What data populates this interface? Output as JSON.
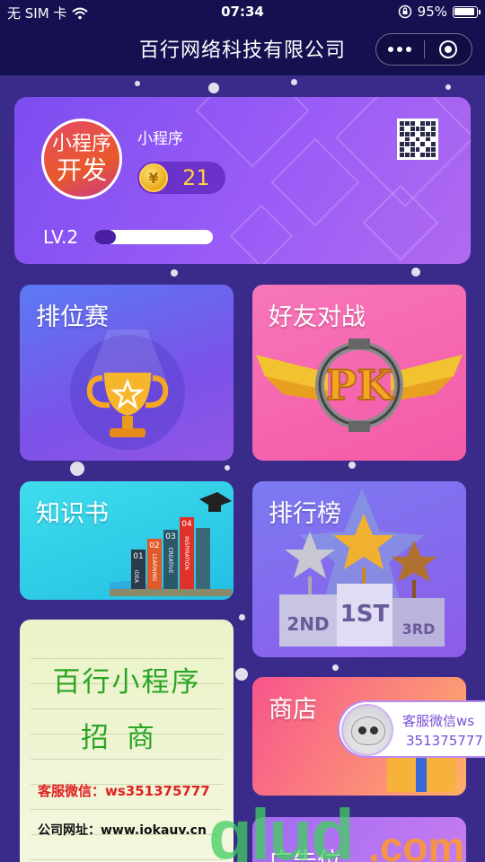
{
  "status_bar": {
    "carrier": "无 SIM 卡",
    "time": "07:34",
    "battery": "95%"
  },
  "nav": {
    "title": "百行网络科技有限公司",
    "more_icon": "more-dots-icon",
    "close_icon": "target-close-icon"
  },
  "profile": {
    "avatar_line1": "小程序",
    "avatar_line2": "开发",
    "username": "小程序",
    "coin_symbol": "¥",
    "coins": "21",
    "level": "LV.2",
    "level_progress": 0.18,
    "qr_icon": "qr-code-icon"
  },
  "cards": {
    "rank": {
      "title": "排位赛",
      "icon": "trophy-icon"
    },
    "pk": {
      "title": "好友对战",
      "badge": "PK",
      "icon": "pk-wings-icon"
    },
    "book": {
      "title": "知识书",
      "icon": "books-icon",
      "book_numbers": [
        "01",
        "02",
        "03",
        "04"
      ],
      "book_labels": [
        "IDEA",
        "LEARNING",
        "CREATIVE",
        "INSPIRATION"
      ]
    },
    "board": {
      "title": "排行榜",
      "icon": "podium-stars-icon",
      "podium": [
        "2ND",
        "1ST",
        "3RD"
      ]
    },
    "shop": {
      "title": "商店",
      "icon": "shop-box-icon"
    },
    "adpos": {
      "title": "广告位"
    }
  },
  "ad": {
    "line1": "百行小程序",
    "line2": "招商",
    "wechat": "客服微信：ws351375777",
    "website": "公司网址：www.iokauv.cn"
  },
  "support": {
    "label": "客服微信ws",
    "number": "351375777",
    "icon": "cat-avatar-icon"
  },
  "watermark": {
    "text": "glud",
    "suffix": ".com"
  },
  "colors": {
    "background": "#3a2a8a",
    "nav_bg": "#151150",
    "profile_card": "#8b55f4",
    "rank_card": "#6a66ee",
    "pk_card": "#f46aaf",
    "book_card": "#30cfe8",
    "board_card": "#8468ec",
    "shop_card": "#f9707f",
    "coin_text": "#ffd33a",
    "ad_green": "#2aa524",
    "ad_red": "#e02020"
  }
}
